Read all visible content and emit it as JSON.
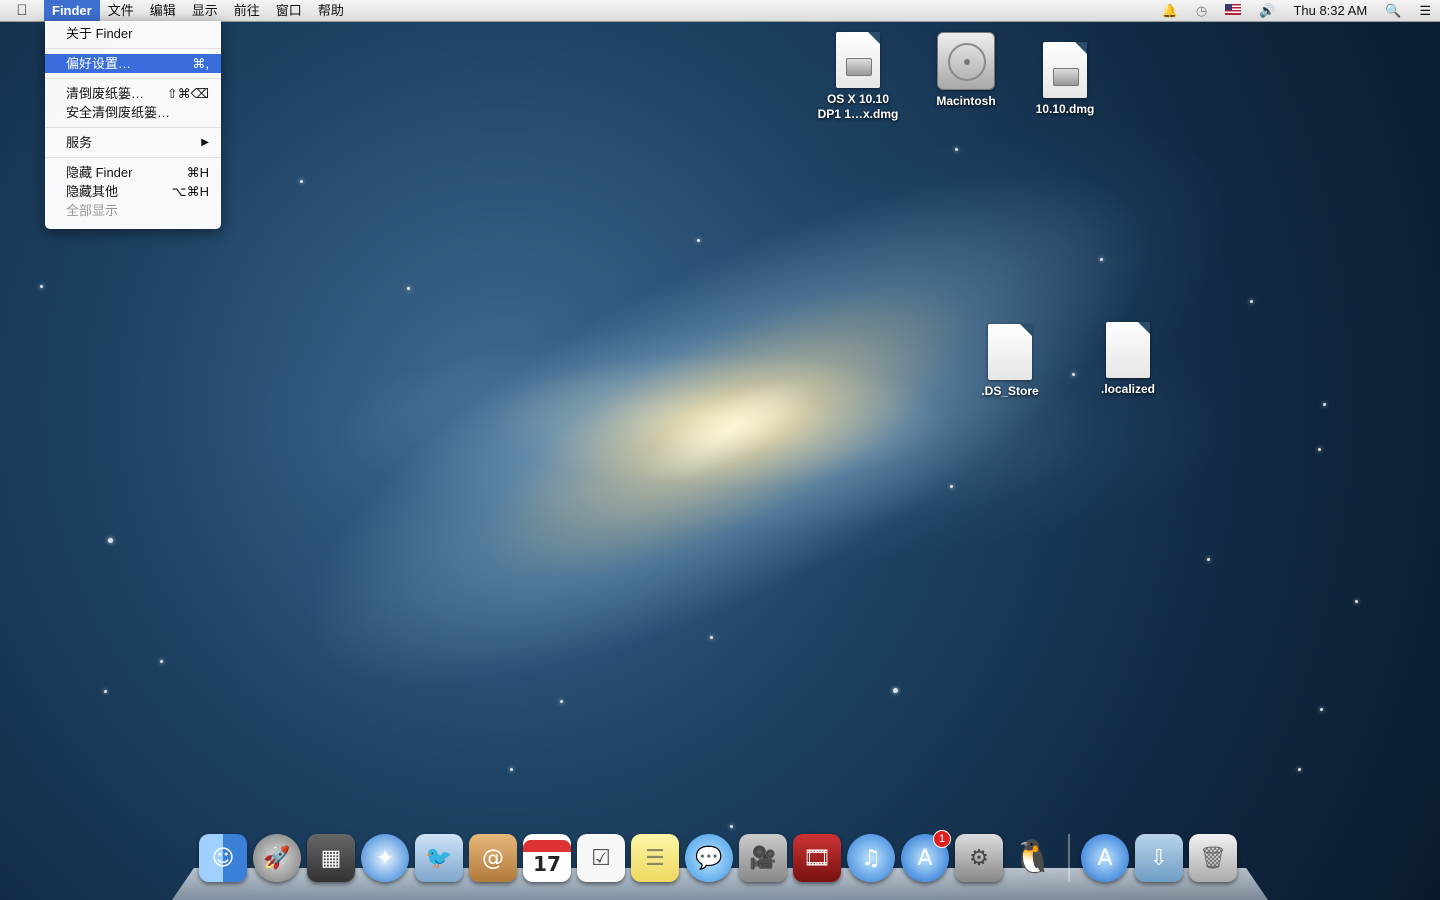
{
  "menubar": {
    "apple_icon": "apple-icon",
    "menus": [
      "Finder",
      "文件",
      "编辑",
      "显示",
      "前往",
      "窗口",
      "帮助"
    ],
    "clock": "Thu 8:32 AM"
  },
  "finder_menu": {
    "about": "关于 Finder",
    "preferences": "偏好设置…",
    "preferences_shortcut": "⌘,",
    "empty_trash": "清倒废纸篓…",
    "empty_trash_shortcut": "⇧⌘⌫",
    "secure_empty_trash": "安全清倒废纸篓…",
    "services": "服务",
    "services_arrow": "▶",
    "hide_finder": "隐藏 Finder",
    "hide_finder_shortcut": "⌘H",
    "hide_others": "隐藏其他",
    "hide_others_shortcut": "⌥⌘H",
    "show_all": "全部显示"
  },
  "desktop_icons": {
    "osx_dmg": "OS X 10.10\nDP1 1…x.dmg",
    "macintosh": "Macintosh",
    "dmg_1010": "10.10.dmg",
    "ds_store": ".DS_Store",
    "localized": ".localized"
  },
  "dock": {
    "calendar_day": "17",
    "app_store_badge": "1"
  }
}
